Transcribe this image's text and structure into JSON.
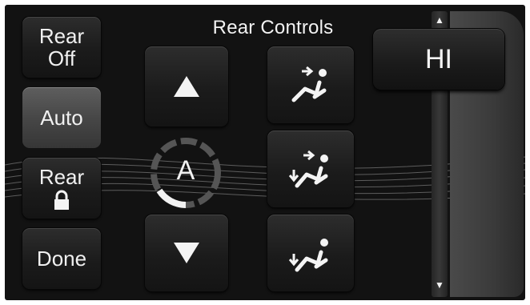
{
  "header": {
    "title": "Rear Controls"
  },
  "left_buttons": {
    "rear_off": "Rear\nOff",
    "auto": "Auto",
    "rear_lock": "Rear",
    "done": "Done"
  },
  "temperature": {
    "mode_label": "A"
  },
  "fan": {
    "level_label": "HI"
  },
  "icons": {
    "temp_up": "up-arrow-icon",
    "temp_down": "down-arrow-icon",
    "lock": "lock-icon",
    "mode_panel": "panel-vent-icon",
    "mode_bilevel": "bilevel-icon",
    "mode_floor": "floor-icon"
  },
  "colors": {
    "text": "#f0f0f0",
    "active_button": "#4a4a4a",
    "screen": "#121212"
  }
}
